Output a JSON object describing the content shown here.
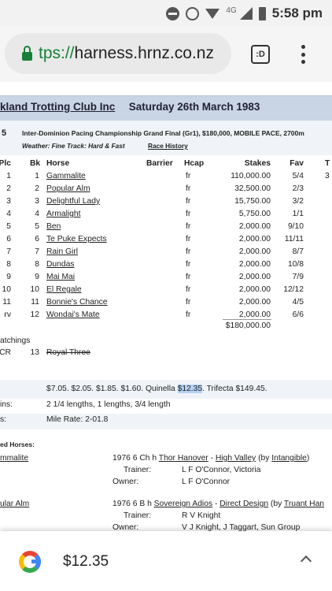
{
  "status_bar": {
    "network": "4G",
    "time": "5:58 pm"
  },
  "browser": {
    "url_scheme": "tps://",
    "url_host": "harness.hrnz.co.nz",
    "tabs_label": ":D"
  },
  "page": {
    "club": "kland Trotting Club Inc",
    "date": "Saturday  26th  March  1983",
    "race_number": "5",
    "race_title": "Inter-Dominion Pacing Championship Grand Final (Gr1), $180,000, MOBILE PACE, 2700m",
    "race_conditions": "Weather: Fine    Track: Hard & Fast",
    "race_history_link": "Race History",
    "headers": {
      "plc": "Plc",
      "bk": "Bk",
      "horse": "Horse",
      "barrier": "Barrier",
      "hcap": "Hcap",
      "stakes": "Stakes",
      "fav": "Fav",
      "extra": "T"
    },
    "rows": [
      {
        "plc": "1",
        "bk": "1",
        "horse": "Gammalite",
        "hcap": "fr",
        "stakes": "110,000.00",
        "fav": "5/4",
        "extra": "3"
      },
      {
        "plc": "2",
        "bk": "2",
        "horse": "Popular Alm",
        "hcap": "fr",
        "stakes": "32,500.00",
        "fav": "2/3",
        "extra": ""
      },
      {
        "plc": "3",
        "bk": "3",
        "horse": "Delightful Lady",
        "hcap": "fr",
        "stakes": "15,750.00",
        "fav": "3/2",
        "extra": ""
      },
      {
        "plc": "4",
        "bk": "4",
        "horse": "Armalight",
        "hcap": "fr",
        "stakes": "5,750.00",
        "fav": "1/1",
        "extra": ""
      },
      {
        "plc": "5",
        "bk": "5",
        "horse": "Ben",
        "hcap": "fr",
        "stakes": "2,000.00",
        "fav": "9/10",
        "extra": ""
      },
      {
        "plc": "6",
        "bk": "6",
        "horse": "Te Puke Expects",
        "hcap": "fr",
        "stakes": "2,000.00",
        "fav": "11/11",
        "extra": ""
      },
      {
        "plc": "7",
        "bk": "7",
        "horse": "Rain Girl",
        "hcap": "fr",
        "stakes": "2,000.00",
        "fav": "8/7",
        "extra": ""
      },
      {
        "plc": "8",
        "bk": "8",
        "horse": "Dundas",
        "hcap": "fr",
        "stakes": "2,000.00",
        "fav": "10/8",
        "extra": ""
      },
      {
        "plc": "9",
        "bk": "9",
        "horse": "Mai Mai",
        "hcap": "fr",
        "stakes": "2,000.00",
        "fav": "7/9",
        "extra": ""
      },
      {
        "plc": "10",
        "bk": "10",
        "horse": "El Regale",
        "hcap": "fr",
        "stakes": "2,000.00",
        "fav": "12/12",
        "extra": ""
      },
      {
        "plc": "11",
        "bk": "11",
        "horse": "Bonnie's Chance",
        "hcap": "fr",
        "stakes": "2,000.00",
        "fav": "4/5",
        "extra": ""
      },
      {
        "plc": "rv",
        "bk": "12",
        "horse": "Wondai's Mate",
        "hcap": "fr",
        "stakes": "2,000.00",
        "fav": "6/6",
        "extra": ""
      }
    ],
    "stakes_total": "$180,000.00",
    "scratchings_label": "atchings",
    "scratching": {
      "code": "CR",
      "bk": "13",
      "horse": "Royal Three"
    },
    "dividends": {
      "before": "$7.05. $2.05. $1.85. $1.60. Quinella ",
      "highlight": "$12.35",
      "after": ". Trifecta $149.45."
    },
    "margins": {
      "label": "ins:",
      "value": "2 1/4 lengths, 1 lengths, 3/4 length"
    },
    "time": {
      "label": "s:",
      "value": "Mile Rate: 2-01.8"
    },
    "placed_heading": "ed Horses:",
    "placed": [
      {
        "name": "mmalite",
        "pedigree_prefix": "1976 6 Ch h ",
        "sire": "Thor Hanover",
        "sep": " - ",
        "dam": "High Valley",
        "by_open": "  (by ",
        "damsire": "Intangible",
        "by_close": ")",
        "trainer_label": "Trainer:",
        "trainer": "L F O'Connor, Victoria",
        "owner_label": "Owner:",
        "owner": "L F O'Connor"
      },
      {
        "name": "ular Alm",
        "pedigree_prefix": "1976 6 B h ",
        "sire": "Sovereign Adios",
        "sep": " - ",
        "dam": "Direct Design",
        "by_open": "  (by ",
        "damsire": "Truant Han",
        "by_close": "",
        "trainer_label": "Trainer:",
        "trainer": "R V Knight",
        "owner_label": "Owner:",
        "owner": "V J Knight, J Taggart, Sun Group"
      }
    ]
  },
  "find_bar": {
    "text": "$12.35"
  }
}
